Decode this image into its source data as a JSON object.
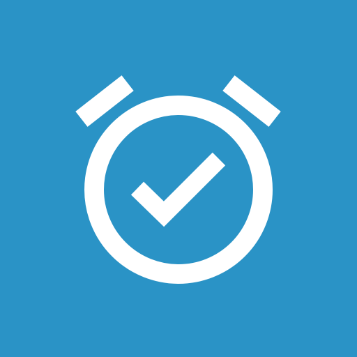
{
  "icon": {
    "name": "alarm-clock-check-icon",
    "background_color": "#2A93C6",
    "foreground_color": "#FFFFFF"
  }
}
